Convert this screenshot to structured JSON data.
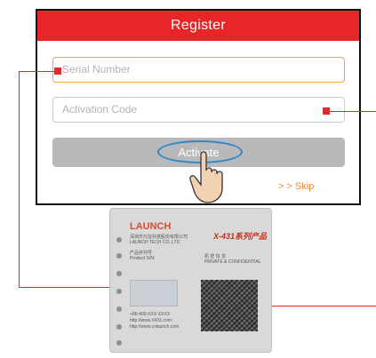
{
  "dialog": {
    "title": "Register",
    "serial_placeholder": "Serial Number",
    "activation_placeholder": "Activation Code",
    "activate_label": "Activate",
    "skip_label": "> > Skip"
  },
  "card": {
    "logo": "LAUNCH",
    "company_cn": "深圳市元征科技股份有限公司",
    "company_en": "LAUNCH TECH CO.,LTD.",
    "product_line1": "产品序列号",
    "product_line2": "Product S/N:",
    "brand": "X-431系列产品",
    "confidential_cn": "机 密 信 息",
    "confidential_en": "PRIVATE & CONFIDENTIAL",
    "phone": "+86-400-XXX-XXXX",
    "url1": "http://www.X431.com",
    "url2": "http://www.cnlaunch.com"
  },
  "colors": {
    "accent": "#e8262a",
    "skip": "#f28a2b",
    "highlight": "#2f86c8"
  }
}
